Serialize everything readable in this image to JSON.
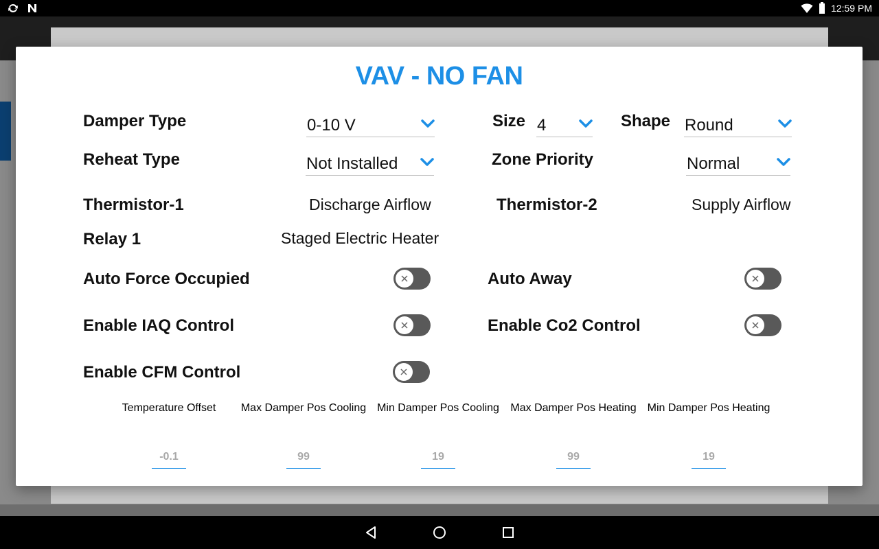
{
  "status_bar": {
    "time": "12:59 PM",
    "left_icons": [
      "sync-icon",
      "notification-n-icon"
    ],
    "right_icons": [
      "wifi-icon",
      "battery-icon"
    ]
  },
  "dialog": {
    "title": "VAV - NO FAN",
    "damper_type": {
      "label": "Damper Type",
      "value": "0-10 V"
    },
    "size": {
      "label": "Size",
      "value": "4"
    },
    "shape": {
      "label": "Shape",
      "value": "Round"
    },
    "reheat_type": {
      "label": "Reheat Type",
      "value": "Not Installed"
    },
    "zone_priority": {
      "label": "Zone Priority",
      "value": "Normal"
    },
    "thermistor_1": {
      "label": "Thermistor-1",
      "value": "Discharge Airflow"
    },
    "thermistor_2": {
      "label": "Thermistor-2",
      "value": "Supply Airflow"
    },
    "relay_1": {
      "label": "Relay 1",
      "value": "Staged Electric Heater"
    },
    "toggles": {
      "auto_force_occupied": {
        "label": "Auto Force Occupied",
        "on": false
      },
      "auto_away": {
        "label": "Auto Away",
        "on": false
      },
      "enable_iaq": {
        "label": "Enable IAQ Control",
        "on": false
      },
      "enable_co2": {
        "label": "Enable Co2 Control",
        "on": false
      },
      "enable_cfm": {
        "label": "Enable CFM Control",
        "on": false
      }
    },
    "numeric_fields": [
      {
        "label": "Temperature\n Offset",
        "value": "-0.1"
      },
      {
        "label": "Max Damper Pos\nCooling",
        "value": "99"
      },
      {
        "label": "Min Damper Pos\nCooling",
        "value": "19"
      },
      {
        "label": "Max Damper Pos\nHeating",
        "value": "99"
      },
      {
        "label": "Min Damper Pos\nHeating",
        "value": "19"
      }
    ]
  },
  "colors": {
    "accent": "#1d8fe6",
    "toggle_off_track": "#595959",
    "muted_value": "#a8a8a8"
  },
  "nav_bar": {
    "buttons": [
      "back-icon",
      "home-icon",
      "recents-icon"
    ]
  }
}
